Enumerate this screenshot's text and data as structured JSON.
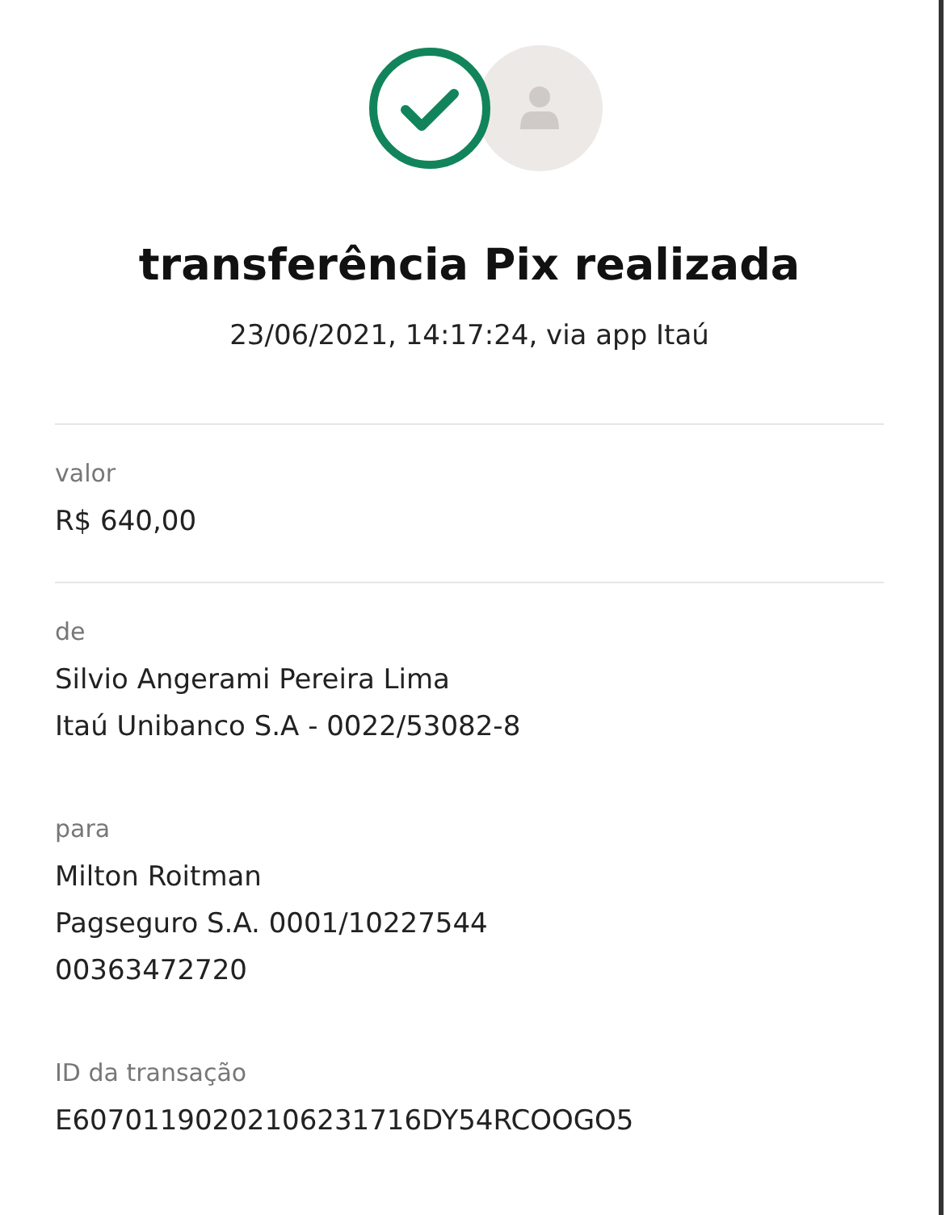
{
  "header": {
    "title": "transferência Pix realizada",
    "subtitle": "23/06/2021, 14:17:24, via app Itaú"
  },
  "sections": [
    {
      "label": "valor",
      "lines": [
        "R$ 640,00"
      ],
      "divider": true
    },
    {
      "label": "de",
      "lines": [
        "Silvio Angerami Pereira Lima",
        "Itaú Unibanco S.A - 0022/53082-8"
      ],
      "divider": false
    },
    {
      "label": "para",
      "lines": [
        "Milton Roitman",
        "Pagseguro S.A. 0001/10227544",
        "00363472720"
      ],
      "divider": false
    },
    {
      "label": "ID da transação",
      "lines": [
        "E60701190202106231716DY54RCOOGO5"
      ],
      "divider": false
    }
  ]
}
